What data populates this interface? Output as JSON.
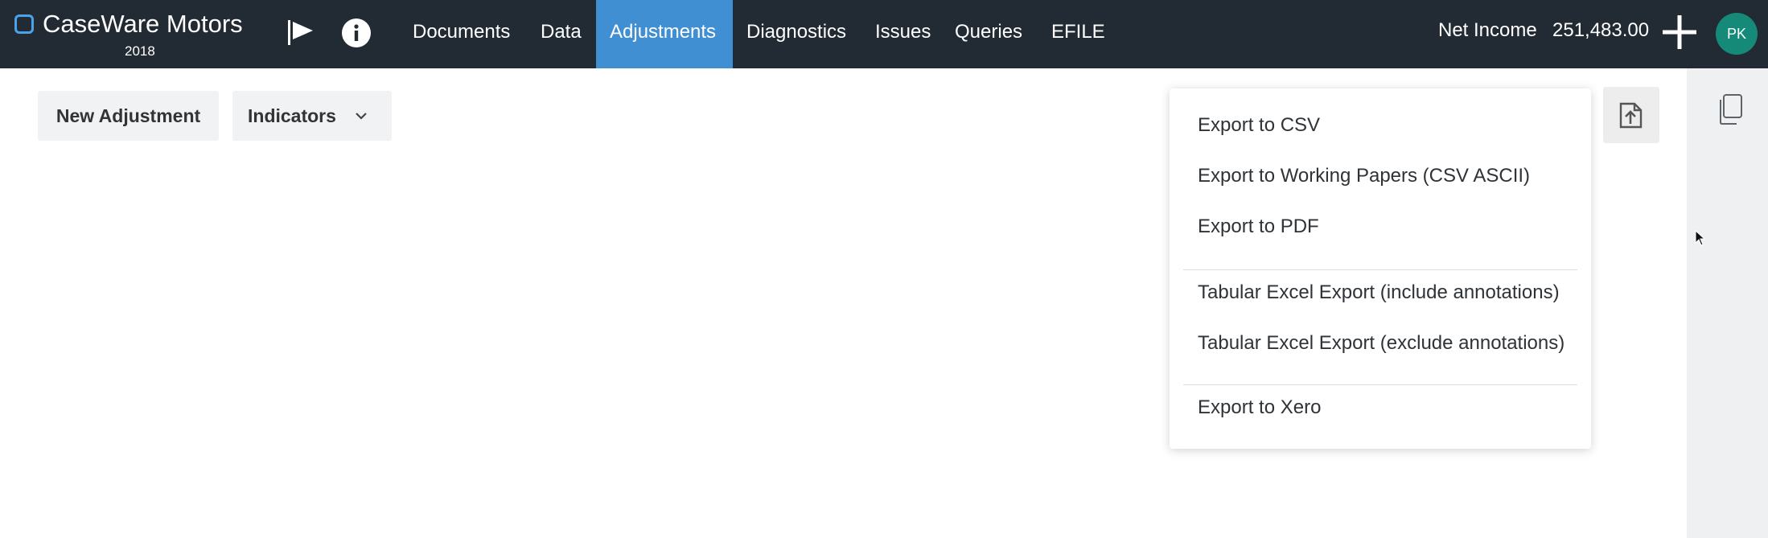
{
  "header": {
    "app_name": "CaseWare Motors",
    "year": "2018",
    "icons": [
      "flag-icon",
      "info-icon",
      "plus-icon"
    ],
    "nav": [
      {
        "label": "Documents",
        "active": false
      },
      {
        "label": "Data",
        "active": false
      },
      {
        "label": "Adjustments",
        "active": true
      },
      {
        "label": "Diagnostics",
        "active": false
      },
      {
        "label": "Issues",
        "active": false
      },
      {
        "label": "Queries",
        "active": false
      },
      {
        "label": "EFILE",
        "active": false
      }
    ],
    "net_income_label": "Net Income",
    "net_income_value": "251,483.00",
    "avatar_initials": "PK"
  },
  "toolbar": {
    "new_adjustment_label": "New Adjustment",
    "indicators_label": "Indicators"
  },
  "export_menu": {
    "groups": [
      [
        "Export to CSV",
        "Export to Working Papers (CSV ASCII)",
        "Export to PDF"
      ],
      [
        "Tabular Excel Export (include annotations)",
        "Tabular Excel Export (exclude annotations)"
      ],
      [
        "Export to Xero"
      ]
    ]
  },
  "colors": {
    "topbar_bg": "#222b33",
    "active_tab_bg": "#3f8fd2",
    "avatar_bg": "#168a79",
    "brand_accent": "#4aa3e6"
  }
}
